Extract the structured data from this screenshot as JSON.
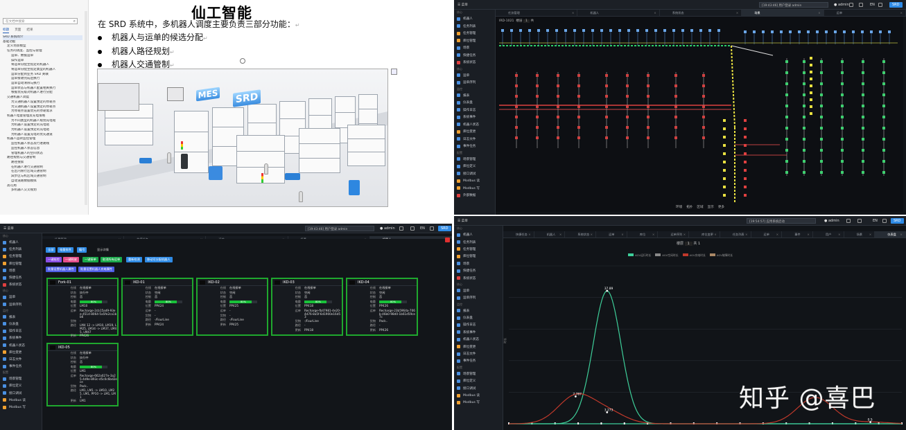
{
  "doc": {
    "title": "仙工智能",
    "intro": "在 SRD 系统中，多机器人调度主要负责三部分功能：",
    "bullets": [
      "机器人与运单的候选分配",
      "机器人路径规划",
      "机器人交通管制"
    ],
    "search_placeholder": "在文档中搜索",
    "nav_tabs": [
      "标题",
      "页面",
      "结果"
    ],
    "tree": [
      "SRD 系统简介",
      "基础功能",
      "定义场景模型",
      "任务的调度、监控与管理",
      "运单、数据运单",
      "操作运单",
      "将运单分配至指定的机器人",
      "将运单分配至指定类型的机器人",
      "运单分配到业务 SRD 关联",
      "运单接收完成后执行",
      "运单自动清除与执行",
      "运单状态与机器人配置相关执行",
      "根据优先级对机器人进行分配",
      "交通机器人调度",
      "为交通机器人设置预定的停靠点",
      "为交通机器人设置预定的停靠点",
      "为停靠点设置优先的停靠需求",
      "机器人电量管理及充电策略",
      "为不同类型的机器人规划充电站",
      "为机器人设置预定的充电站",
      "为机器人设置预定的充电站",
      "为机器人设置充电的优先通道",
      "机器人运转监控管理",
      "监控机器人状态及行进路线",
      "监控机器人状态信息",
      "管理机器人的空间状态",
      "路径规划与交通管制",
      "路径搜索",
      "在机器人进行交通管制",
      "在区内限行区域交通管制",
      "异步区与机区域交通管制",
      "自动道路数据模拟",
      "高可用",
      "多机器人交叉规划"
    ],
    "img_labels": [
      "MES",
      "SRD"
    ]
  },
  "map_app": {
    "menu": "菜单",
    "search": "[19:43:46] 用户登录 admin",
    "user": "admin",
    "lang": "EN",
    "brand": "SRD",
    "tabs": [
      "任务管理",
      "机器人",
      "系统状态",
      "场景",
      "运单"
    ],
    "active_tab": 3,
    "scene_label": "IRD-1021",
    "floor_label": "楼层",
    "floor_value": "1",
    "floor_count": "共",
    "footer": [
      "环境",
      "拓扑",
      "区域",
      "显示",
      "更多"
    ]
  },
  "sidebar": {
    "groups": [
      "核心",
      "监控",
      "配置"
    ],
    "items": [
      {
        "label": "机器人",
        "color": "#4a90e2"
      },
      {
        "label": "任务列表",
        "color": "#4a90e2"
      },
      {
        "label": "任务管理",
        "color": "#f0a030"
      },
      {
        "label": "库位管理",
        "color": "#f0a030"
      },
      {
        "label": "场景",
        "color": "#4a90e2"
      },
      {
        "label": "快捷任务",
        "color": "#4a90e2"
      },
      {
        "label": "系统状态",
        "color": "#e04040"
      },
      {
        "label": "运单",
        "color": "#4a90e2"
      },
      {
        "label": "运单序列",
        "color": "#4a90e2"
      },
      {
        "label": "报表",
        "color": "#4a90e2"
      },
      {
        "label": "仪表盘",
        "color": "#4a90e2"
      },
      {
        "label": "操作日志",
        "color": "#4a90e2"
      },
      {
        "label": "系统事件",
        "color": "#4a90e2"
      },
      {
        "label": "机器人状态",
        "color": "#4a90e2"
      },
      {
        "label": "库位变更",
        "color": "#f0a030"
      },
      {
        "label": "日志文件",
        "color": "#4a90e2"
      },
      {
        "label": "事件任务",
        "color": "#4a90e2"
      },
      {
        "label": "场景管理",
        "color": "#4a90e2"
      },
      {
        "label": "库位定义",
        "color": "#4a90e2"
      },
      {
        "label": "接口调试",
        "color": "#4a90e2"
      },
      {
        "label": "Modbus 读",
        "color": "#f0a030"
      },
      {
        "label": "Modbus 写",
        "color": "#f0a030"
      },
      {
        "label": "外部数据",
        "color": "#e04040"
      }
    ]
  },
  "robot_app": {
    "tabs": [
      "场景管理",
      "快捷任务",
      "运单",
      "场景",
      "机器人"
    ],
    "active_tab": 4,
    "filter_buttons": [
      "全部",
      "电量排序",
      "编号",
      "显示详情"
    ],
    "action_buttons": [
      "一键抢控",
      "一键释放",
      "一键接单",
      "取消所有运单",
      "重新检测",
      "移动可分配机器人"
    ],
    "action_buttons2": [
      "批量设置机器人属性",
      "批量设置机器人充电属性"
    ],
    "robots": [
      {
        "name": "Fork-01",
        "rows": [
          [
            "在线",
            "在线接单"
          ],
          [
            "状态",
            "执行中"
          ],
          [
            "控制",
            "否"
          ],
          [
            "电量",
            "80%"
          ],
          [
            "位置",
            "LM10"
          ],
          [
            "运单",
            "Recharge-2cb15ad9-93ee-4514-8064-5a5fe2ca1bb6"
          ],
          [
            "货物",
            "-"
          ],
          [
            "路径",
            "LM4 12 -> LM10, LM19, LM25, LM34 -> LM37, LM45, LM47"
          ],
          [
            "更新",
            "PP426"
          ]
        ]
      },
      {
        "name": "IKD-01",
        "rows": [
          [
            "在线",
            "在线接单"
          ],
          [
            "状态",
            "空闲"
          ],
          [
            "控制",
            "否"
          ],
          [
            "电量",
            "80%"
          ],
          [
            "位置",
            "PP424"
          ],
          [
            "运单",
            "-"
          ],
          [
            "货物",
            "-"
          ],
          [
            "路径",
            "-/FourLine"
          ],
          [
            "更新",
            "PP424"
          ]
        ]
      },
      {
        "name": "IKD-02",
        "rows": [
          [
            "在线",
            "在线接单"
          ],
          [
            "状态",
            "空闲"
          ],
          [
            "控制",
            "否"
          ],
          [
            "电量",
            "80%"
          ],
          [
            "位置",
            "PP425"
          ],
          [
            "运单",
            "-"
          ],
          [
            "货物",
            "-"
          ],
          [
            "路径",
            "-/FourLine"
          ],
          [
            "更新",
            "PP425"
          ]
        ]
      },
      {
        "name": "IKD-03",
        "rows": [
          [
            "在线",
            "在线接单"
          ],
          [
            "状态",
            "空闲"
          ],
          [
            "控制",
            "否"
          ],
          [
            "电量",
            "80%"
          ],
          [
            "位置",
            "PP418"
          ],
          [
            "运单",
            "Recharge-fb47981-4e20-4d76-8a5f-6d1900e16d53"
          ],
          [
            "货物",
            "-/FourLine"
          ],
          [
            "路径",
            "-"
          ],
          [
            "更新",
            "PP418"
          ]
        ]
      },
      {
        "name": "IKD-04",
        "rows": [
          [
            "在线",
            "在线接单"
          ],
          [
            "状态",
            "空闲"
          ],
          [
            "控制",
            "否"
          ],
          [
            "电量",
            "80%"
          ],
          [
            "位置",
            "PP426"
          ],
          [
            "运单",
            "Recharge-23b5964a-706b-46b0-98d0-1b61d59ce7c"
          ],
          [
            "货物",
            "Pack.."
          ],
          [
            "路径",
            "-"
          ],
          [
            "更新",
            "PP426"
          ]
        ]
      },
      {
        "name": "IKD-05",
        "rows": [
          [
            "在线",
            "在线接单"
          ],
          [
            "状态",
            "执行中"
          ],
          [
            "控制",
            "否"
          ],
          [
            "电量",
            "80%"
          ],
          [
            "位置",
            "LM1"
          ],
          [
            "运单",
            "Recharge-662a027e-3a25-4d9e-893c-d5c0c6bd2ece"
          ],
          [
            "货物",
            "Pack.."
          ],
          [
            "路径",
            "LM1, LM1 -> LM10, LM25, LM1, PP10 -> LM1, LM1"
          ],
          [
            "更新",
            "LM1"
          ]
        ]
      }
    ],
    "battery_pct": [
      0.8,
      0.8,
      0.8,
      0.8,
      0.8,
      0.8
    ]
  },
  "chart_app": {
    "search": "[19:54:57] 应用系统启动",
    "tabs": [
      "快捷任务",
      "机器人",
      "系统状态",
      "运单",
      "库位",
      "运单序列",
      "库位变更",
      "任务列表",
      "运单",
      "事件",
      "用户",
      "场景",
      "仪表盘"
    ],
    "active_tab": 12,
    "floor_label": "楼层",
    "floor_value": "1",
    "floor_count": "共",
    "floor_total": "1",
    "legend": [
      "AGV运行时长",
      "AGV空闲时长",
      "AGV充电时长",
      "AGV故障时长"
    ]
  },
  "chart_data": {
    "type": "line",
    "xlabel": "",
    "ylabel": "时长",
    "series": [
      {
        "name": "AGV运行时长",
        "color": "#3ecf9a",
        "peaks": [
          {
            "x": 0.25,
            "y": 37.89
          }
        ],
        "width": 0.035
      },
      {
        "name": "AGV空闲时长",
        "color": "#c0392b",
        "peaks": [
          {
            "x": 0.17,
            "y": 7.787
          },
          {
            "x": 0.25,
            "y": 3.273
          },
          {
            "x": 0.78,
            "y": 7.5
          },
          {
            "x": 0.92,
            "y": 0.5
          }
        ],
        "width": 0.045
      }
    ],
    "annotations": [
      "37.89",
      "7.787",
      "3.273",
      "0.5"
    ],
    "ylim": [
      0,
      45
    ]
  },
  "watermark": "知乎 @喜巴"
}
